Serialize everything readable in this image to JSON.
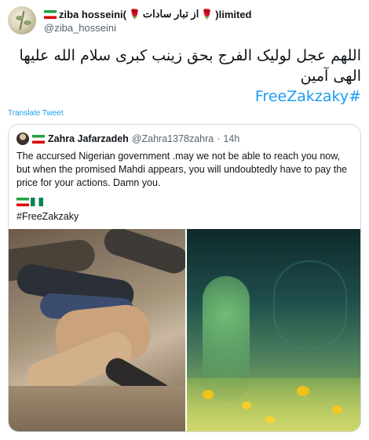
{
  "author": {
    "display_name_prefix": "ziba hosseini(",
    "display_name_persian": "از تبار سادات",
    "display_name_suffix": ")limited",
    "handle": "@ziba_hosseini"
  },
  "tweet": {
    "text": "اللهم عجل لولیک الفرج بحق زینب کبری سلام الله علیها الهی آمین",
    "hashtag": "#FreeZakzaky",
    "translate_label": "Translate Tweet"
  },
  "quoted_tweet": {
    "name": "Zahra Jafarzadeh",
    "handle": "@Zahra1378zahra",
    "separator": "·",
    "time": "14h",
    "text": "The accursed Nigerian government .may we not be able to reach you now, but when the promised Mahdi appears, you will undoubtedly have to pay the price for your actions. Damn you.",
    "hashtag": "#FreeZakzaky"
  },
  "icons": {
    "avatar": "user-avatar",
    "rose": "rose-icon",
    "flag_iran": "flag-iran-icon",
    "flag_nigeria": "flag-nigeria-icon"
  },
  "colors": {
    "link": "#1d9bf0",
    "secondary_text": "#536471",
    "border": "#cfd9de"
  }
}
